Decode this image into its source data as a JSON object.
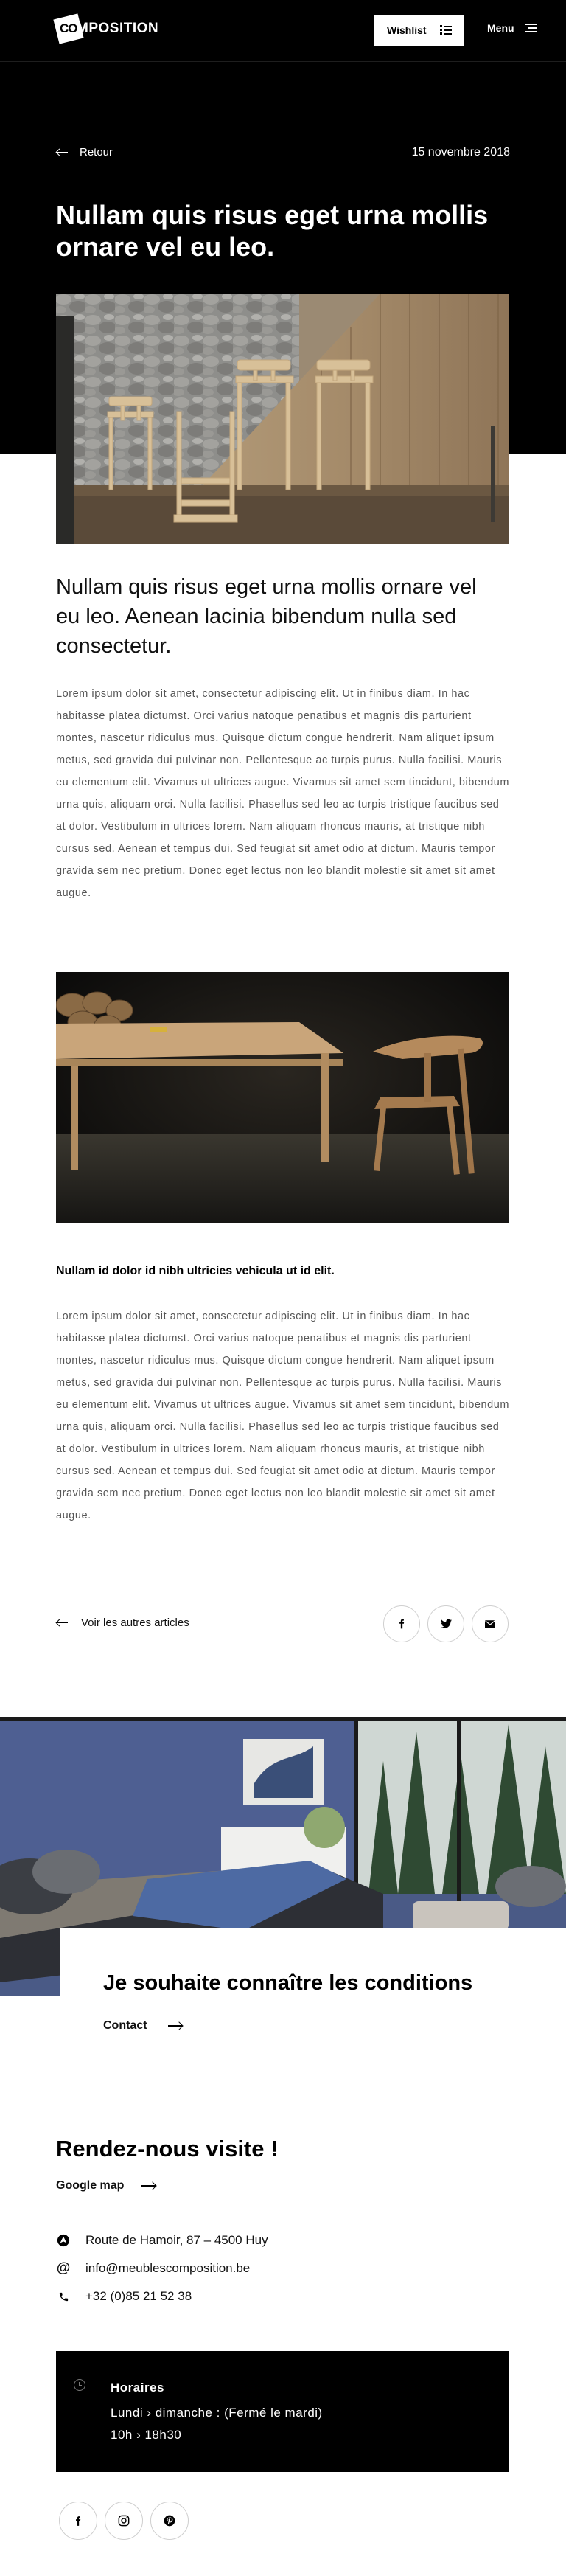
{
  "header": {
    "logo_mark": "CO",
    "logo_text": "MPOSITION",
    "wishlist_label": "Wishlist",
    "menu_label": "Menu"
  },
  "article": {
    "back_label": "Retour",
    "date": "15 novembre 2018",
    "title": "Nullam quis risus eget urna mollis ornare vel eu leo.",
    "lead": "Nullam quis risus eget urna mollis ornare vel eu leo. Aenean lacinia bibendum nulla sed consectetur.",
    "body_1": "Lorem ipsum dolor sit amet, consectetur adipiscing elit. Ut in finibus diam. In hac habitasse platea dictumst. Orci varius natoque penatibus et magnis dis parturient montes, nascetur ridiculus mus. Quisque dictum congue hendrerit. Nam aliquet ipsum metus, sed gravida dui pulvinar non. Pellentesque ac turpis purus. Nulla facilisi. Mauris eu elementum elit. Vivamus ut ultrices augue. Vivamus sit amet sem tincidunt, bibendum urna quis, aliquam orci. Nulla facilisi. Phasellus sed leo ac turpis tristique faucibus sed at dolor. Vestibulum in ultrices lorem. Nam aliquam rhoncus mauris, at tristique nibh cursus sed. Aenean et tempus dui. Sed feugiat sit amet odio at dictum. Mauris tempor gravida sem nec pretium. Donec eget lectus non leo blandit molestie sit amet sit amet augue.",
    "subheading": "Nullam id dolor id nibh ultricies vehicula ut id elit.",
    "body_2": "Lorem ipsum dolor sit amet, consectetur adipiscing elit. Ut in finibus diam. In hac habitasse platea dictumst. Orci varius natoque penatibus et magnis dis parturient montes, nascetur ridiculus mus. Quisque dictum congue hendrerit. Nam aliquet ipsum metus, sed gravida dui pulvinar non. Pellentesque ac turpis purus. Nulla facilisi. Mauris eu elementum elit. Vivamus ut ultrices augue. Vivamus sit amet sem tincidunt, bibendum urna quis, aliquam orci. Nulla facilisi. Phasellus sed leo ac turpis tristique faucibus sed at dolor. Vestibulum in ultrices lorem. Nam aliquam rhoncus mauris, at tristique nibh cursus sed. Aenean et tempus dui. Sed feugiat sit amet odio at dictum. Mauris tempor gravida sem nec pretium. Donec eget lectus non leo blandit molestie sit amet sit amet augue.",
    "other_articles_label": "Voir les autres articles",
    "share_icons": [
      "facebook-icon",
      "twitter-icon",
      "mail-icon"
    ]
  },
  "promo": {
    "title": "Je souhaite connaître les conditions",
    "contact_label": "Contact"
  },
  "visit": {
    "title": "Rendez-nous visite !",
    "map_label": "Google map",
    "address": "Route de Hamoir, 87 – 4500 Huy",
    "email": "info@meublescomposition.be",
    "phone": "+32 (0)85 21 52 38"
  },
  "hours": {
    "title": "Horaires",
    "days": "Lundi › dimanche :  (Fermé le mardi)",
    "time": "10h › 18h30"
  },
  "social_icons": [
    "facebook-icon",
    "instagram-icon",
    "pinterest-icon"
  ],
  "colors": {
    "background_dark": "#000000",
    "background_light": "#ffffff",
    "text_muted": "#555555"
  }
}
